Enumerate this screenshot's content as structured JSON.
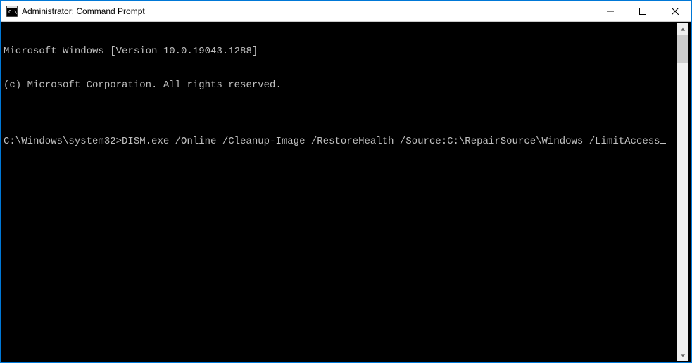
{
  "window": {
    "title": "Administrator: Command Prompt"
  },
  "terminal": {
    "line1": "Microsoft Windows [Version 10.0.19043.1288]",
    "line2": "(c) Microsoft Corporation. All rights reserved.",
    "blank": "",
    "prompt": "C:\\Windows\\system32>",
    "command": "DISM.exe /Online /Cleanup-Image /RestoreHealth /Source:C:\\RepairSource\\Windows /LimitAccess"
  }
}
